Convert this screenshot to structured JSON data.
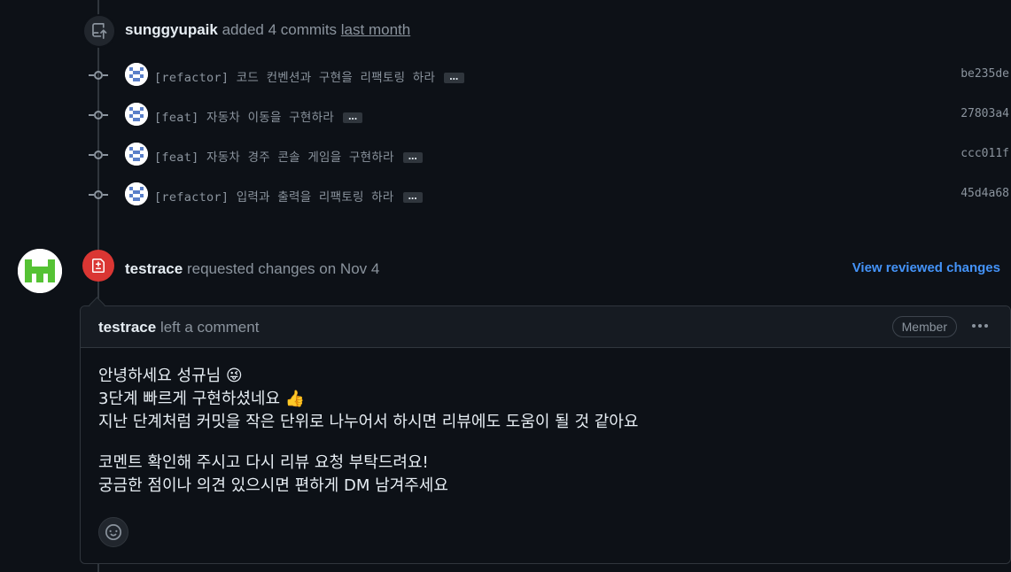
{
  "push_event": {
    "actor": "sunggyupaik",
    "action": "added 4 commits",
    "when": "last month"
  },
  "commits": [
    {
      "message": "[refactor] 코드 컨벤션과 구현을 리팩토링 하라",
      "ellipsis": "…",
      "sha": "be235de"
    },
    {
      "message": "[feat] 자동차 이동을 구현하라",
      "ellipsis": "…",
      "sha": "27803a4"
    },
    {
      "message": "[feat] 자동차 경주 콘솔 게임을 구현하라",
      "ellipsis": "…",
      "sha": "ccc011f"
    },
    {
      "message": "[refactor] 입력과 출력을 리팩토링 하라",
      "ellipsis": "…",
      "sha": "45d4a68"
    }
  ],
  "review_event": {
    "actor": "testrace",
    "action": "requested changes on Nov 4",
    "view_link": "View reviewed changes"
  },
  "comment": {
    "actor": "testrace",
    "action": "left a comment",
    "role_badge": "Member",
    "lines": [
      "안녕하세요 성규님 😜",
      "3단계 빠르게 구현하셨네요 👍",
      "지난 단계처럼 커밋을 작은 단위로 나누어서 하시면 리뷰에도 도움이 될 것 같아요",
      "코멘트 확인해 주시고 다시 리뷰 요청 부탁드려요!",
      "궁금한 점이나 의견 있으시면 편하게 DM 남겨주세요"
    ]
  },
  "colors": {
    "background": "#0d1117",
    "border": "#30363d",
    "muted_text": "#8b949e",
    "link": "#4493f8",
    "changes_requested": "#da3633",
    "reviewer_avatar_green": "#55c234"
  },
  "icons": {
    "push": "repo-push-icon",
    "commit": "git-commit-icon",
    "review": "file-diff-icon",
    "kebab": "kebab-horizontal-icon",
    "reaction": "smiley-icon"
  }
}
